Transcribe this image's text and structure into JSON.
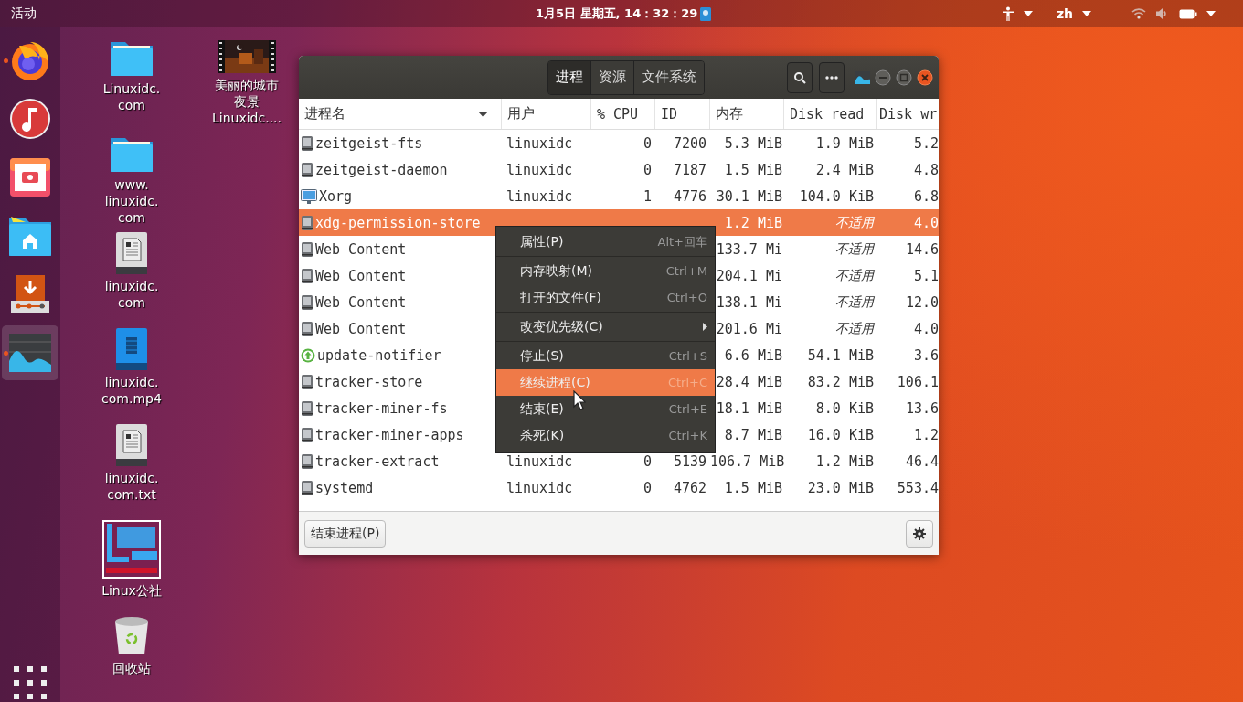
{
  "top_bar": {
    "activities": "活动",
    "clock": "1月5日 星期五, 14：32：29",
    "language": "zh"
  },
  "dock": [
    {
      "kind": "firefox",
      "running": true,
      "selected": false
    },
    {
      "kind": "music",
      "running": false,
      "selected": false
    },
    {
      "kind": "screenshot",
      "running": false,
      "selected": false
    },
    {
      "kind": "files",
      "running": false,
      "selected": false
    },
    {
      "kind": "installer",
      "running": false,
      "selected": false
    },
    {
      "kind": "monitor",
      "running": true,
      "selected": true
    }
  ],
  "desktop_column_1": [
    {
      "kind": "folder",
      "lines": [
        "Linuxidc.",
        "com"
      ]
    },
    {
      "kind": "folder",
      "lines": [
        "www.",
        "linuxidc.",
        "com"
      ]
    },
    {
      "kind": "text",
      "lines": [
        "linuxidc.",
        "com"
      ]
    },
    {
      "kind": "video",
      "lines": [
        "linuxidc.",
        "com.mp4"
      ]
    },
    {
      "kind": "text",
      "lines": [
        "linuxidc.",
        "com.txt"
      ]
    },
    {
      "kind": "picture",
      "lines": [
        "Linux公社"
      ]
    },
    {
      "kind": "trash",
      "lines": [
        "回收站"
      ]
    }
  ],
  "desktop_column_2": [
    {
      "kind": "picture",
      "lines": [
        "美丽的城市",
        "夜景",
        "Linuxidc...."
      ]
    }
  ],
  "window": {
    "tabs": [
      {
        "label": "进程",
        "selected": true
      },
      {
        "label": "资源",
        "selected": false
      },
      {
        "label": "文件系统",
        "selected": false
      }
    ],
    "columns": [
      {
        "label": "进程名",
        "sorted": true
      },
      {
        "label": "用户",
        "sorted": false
      },
      {
        "label": "% CPU",
        "sorted": false
      },
      {
        "label": "ID",
        "sorted": false
      },
      {
        "label": "内存",
        "sorted": false
      },
      {
        "label": "Disk read"
      },
      {
        "label": "Disk wr"
      }
    ],
    "rows": [
      {
        "kind": "program",
        "name": "zeitgeist-fts",
        "user": "linuxidc",
        "cpu": "0",
        "id": "7200",
        "memory": "5.3 MiB",
        "disk_read": "1.9 MiB",
        "read_na": false,
        "disk_write": "5.2",
        "selected": false
      },
      {
        "kind": "program",
        "name": "zeitgeist-daemon",
        "user": "linuxidc",
        "cpu": "0",
        "id": "7187",
        "memory": "1.5 MiB",
        "disk_read": "2.4 MiB",
        "read_na": false,
        "disk_write": "4.8",
        "selected": false
      },
      {
        "kind": "display",
        "name": "Xorg",
        "user": "linuxidc",
        "cpu": "1",
        "id": "4776",
        "memory": "30.1 MiB",
        "disk_read": "104.0 KiB",
        "read_na": false,
        "disk_write": "6.8",
        "selected": false
      },
      {
        "kind": "program",
        "name": "xdg-permission-store",
        "memory": "1.2 MiB",
        "disk_read": "不适用",
        "read_na": true,
        "disk_write": "4.0",
        "selected": true
      },
      {
        "kind": "program",
        "name": "Web Content",
        "memory": "133.7 Mi",
        "disk_read": "不适用",
        "read_na": true,
        "disk_write": "14.6",
        "selected": false
      },
      {
        "kind": "program",
        "name": "Web Content",
        "memory": "204.1 Mi",
        "disk_read": "不适用",
        "read_na": true,
        "disk_write": "5.1",
        "selected": false
      },
      {
        "kind": "program",
        "name": "Web Content",
        "memory": "138.1 Mi",
        "disk_read": "不适用",
        "read_na": true,
        "disk_write": "12.0",
        "selected": false
      },
      {
        "kind": "program",
        "name": "Web Content",
        "memory": "201.6 Mi",
        "disk_read": "不适用",
        "read_na": true,
        "disk_write": "4.0",
        "selected": false
      },
      {
        "kind": "update",
        "name": "update-notifier",
        "memory": "6.6 MiB",
        "disk_read": "54.1 MiB",
        "read_na": false,
        "disk_write": "3.6",
        "selected": false
      },
      {
        "kind": "program",
        "name": "tracker-store",
        "memory": "28.4 MiB",
        "disk_read": "83.2 MiB",
        "read_na": false,
        "disk_write": "106.1",
        "selected": false
      },
      {
        "kind": "program",
        "name": "tracker-miner-fs",
        "memory": "18.1 MiB",
        "disk_read": "8.0 KiB",
        "read_na": false,
        "disk_write": "13.6",
        "selected": false
      },
      {
        "kind": "program",
        "name": "tracker-miner-apps",
        "memory": "8.7 MiB",
        "disk_read": "16.0 KiB",
        "read_na": false,
        "disk_write": "1.2",
        "selected": false
      },
      {
        "kind": "program",
        "name": "tracker-extract",
        "user": "linuxidc",
        "cpu": "0",
        "id": "5139",
        "memory": "106.7 MiB",
        "disk_read": "1.2 MiB",
        "read_na": false,
        "disk_write": "46.4",
        "selected": false
      },
      {
        "kind": "program",
        "name": "systemd",
        "user": "linuxidc",
        "cpu": "0",
        "id": "4762",
        "memory": "1.5 MiB",
        "disk_read": "23.0 MiB",
        "read_na": false,
        "disk_write": "553.4",
        "selected": false
      }
    ],
    "end_button": "结束进程(P)",
    "context_menu": [
      {
        "kind": "item",
        "label": "属性(P)",
        "shortcut": "Alt+回车",
        "selected": false
      },
      {
        "kind": "separator"
      },
      {
        "kind": "item",
        "label": "内存映射(M)",
        "shortcut": "Ctrl+M",
        "selected": false
      },
      {
        "kind": "item",
        "label": "打开的文件(F)",
        "shortcut": "Ctrl+O",
        "selected": false
      },
      {
        "kind": "separator"
      },
      {
        "kind": "submenu",
        "label": "改变优先级(C)",
        "selected": false
      },
      {
        "kind": "separator"
      },
      {
        "kind": "item",
        "label": "停止(S)",
        "shortcut": "Ctrl+S",
        "selected": false
      },
      {
        "kind": "item",
        "label": "继续进程(C)",
        "shortcut": "Ctrl+C",
        "selected": true
      },
      {
        "kind": "item",
        "label": "结束(E)",
        "shortcut": "Ctrl+E",
        "selected": false
      },
      {
        "kind": "item",
        "label": "杀死(K)",
        "shortcut": "Ctrl+K",
        "selected": false
      }
    ]
  }
}
